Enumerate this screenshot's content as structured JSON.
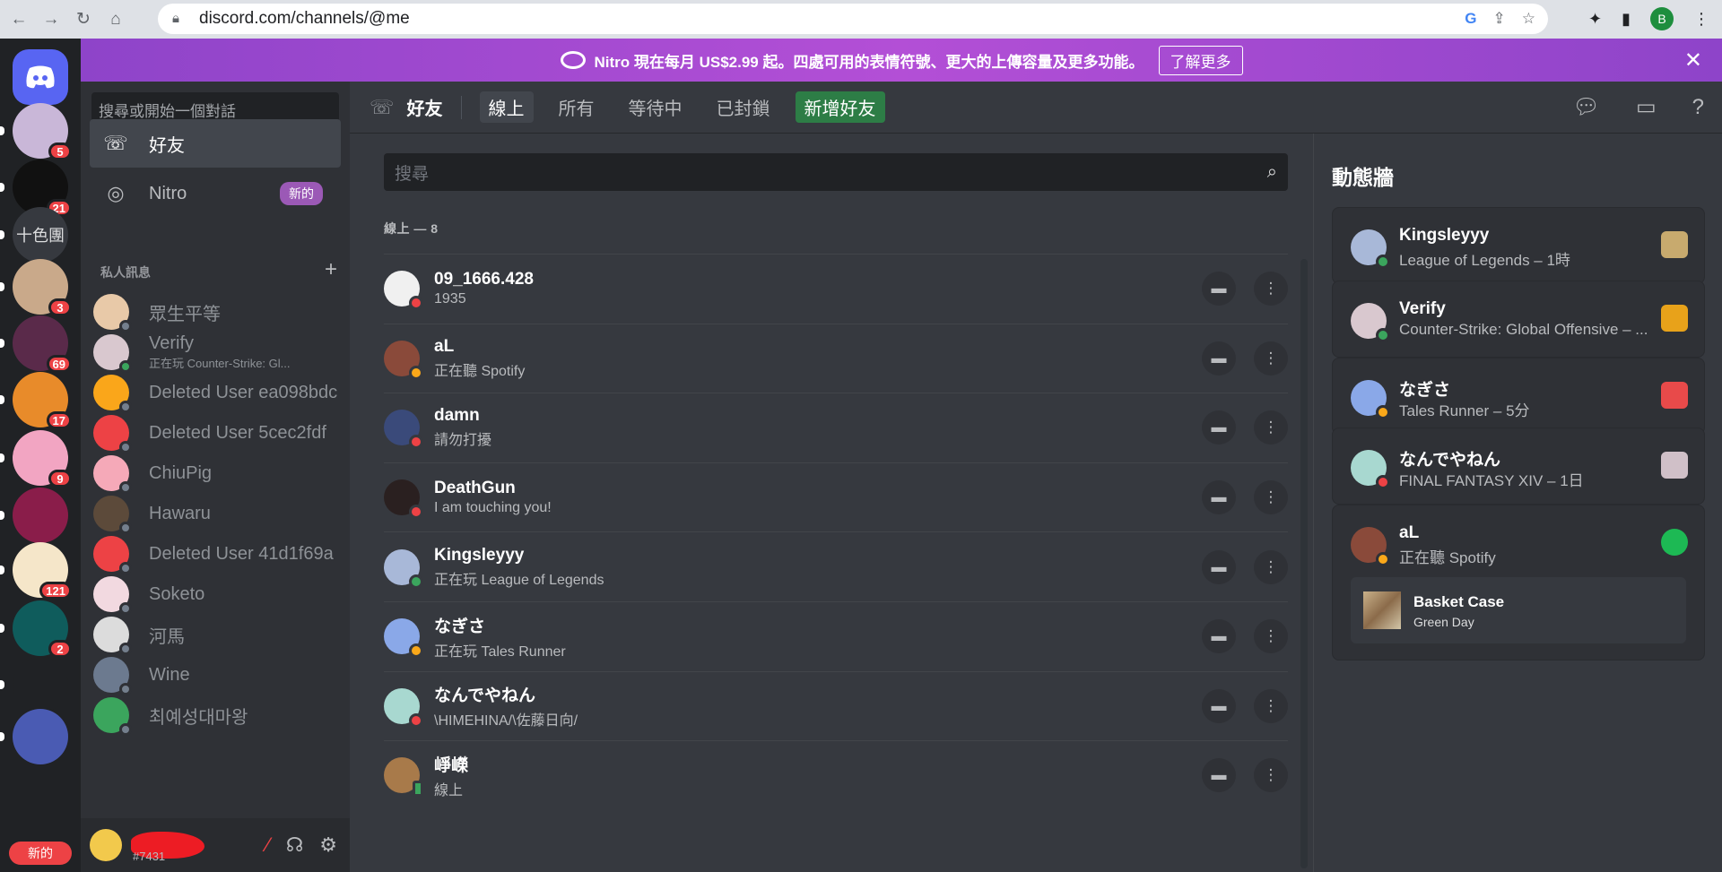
{
  "browser": {
    "url": "discord.com/channels/@me",
    "profile_initial": "B"
  },
  "banner": {
    "text": "Nitro 現在每月 US$2.99 起。四處可用的表情符號、更大的上傳容量及更多功能。",
    "button": "了解更多",
    "close": "✕"
  },
  "rail": {
    "servers": [
      {
        "label": "",
        "badge": "5",
        "color": "#c9b7d8"
      },
      {
        "label": "",
        "badge": "21",
        "color": "#111111"
      },
      {
        "label": "十色團",
        "badge": "",
        "color": "#36393f"
      },
      {
        "label": "",
        "badge": "3",
        "color": "#c9a98a"
      },
      {
        "label": "",
        "badge": "69",
        "color": "#5a2a4a"
      },
      {
        "label": "",
        "badge": "17",
        "color": "#e88b2a"
      },
      {
        "label": "",
        "badge": "9",
        "color": "#f2a5c2"
      },
      {
        "label": "",
        "badge": "",
        "color": "#8a1d4a"
      },
      {
        "label": "",
        "badge": "121",
        "color": "#f5e6c9"
      },
      {
        "label": "",
        "badge": "2",
        "color": "#0f5c5c"
      },
      {
        "label": "",
        "badge": "",
        "color": "#202225"
      },
      {
        "label": "",
        "badge": "",
        "color": "#4a5bb3"
      }
    ],
    "new_label": "新的"
  },
  "sidebar": {
    "search_placeholder": "搜尋或開始一個對話",
    "nav": [
      {
        "label": "好友"
      },
      {
        "label": "Nitro",
        "tag": "新的"
      }
    ],
    "dm_header": "私人訊息",
    "dms": [
      {
        "name": "眾生平等",
        "sub": "",
        "color": "#e8c9a8",
        "status": "offline"
      },
      {
        "name": "Verify",
        "sub": "正在玩 Counter-Strike: Gl...",
        "color": "#d9c8cf",
        "status": "online"
      },
      {
        "name": "Deleted User ea098bdc",
        "sub": "",
        "color": "#faa61a",
        "status": "offline"
      },
      {
        "name": "Deleted User 5cec2fdf",
        "sub": "",
        "color": "#ed4245",
        "status": "offline"
      },
      {
        "name": "ChiuPig",
        "sub": "",
        "color": "#f5a9b8",
        "status": "offline"
      },
      {
        "name": "Hawaru",
        "sub": "",
        "color": "#5c4a3a",
        "status": "offline"
      },
      {
        "name": "Deleted User 41d1f69a",
        "sub": "",
        "color": "#ed4245",
        "status": "offline"
      },
      {
        "name": "Soketo",
        "sub": "",
        "color": "#f2d9e0",
        "status": "offline"
      },
      {
        "name": "河馬",
        "sub": "",
        "color": "#dcdcdc",
        "status": "offline"
      },
      {
        "name": "Wine",
        "sub": "",
        "color": "#6c7a8f",
        "status": "offline"
      },
      {
        "name": "최예성대마왕",
        "sub": "",
        "color": "#3ba55d",
        "status": "offline"
      }
    ]
  },
  "user": {
    "tag": "#7431"
  },
  "header": {
    "title": "好友",
    "tabs": [
      "線上",
      "所有",
      "等待中",
      "已封鎖"
    ],
    "add_friend": "新增好友"
  },
  "friends": {
    "search_placeholder": "搜尋",
    "count_label": "線上 — 8",
    "list": [
      {
        "name": "09_1666.428",
        "sub": "1935",
        "status": "dnd",
        "color": "#f0f0f0"
      },
      {
        "name": "aL",
        "sub": "正在聽 Spotify",
        "status": "idle",
        "color": "#8a4a3a"
      },
      {
        "name": "damn",
        "sub": "請勿打擾",
        "status": "dnd",
        "color": "#3a4a7a"
      },
      {
        "name": "DeathGun",
        "sub": "I am touching you!",
        "status": "dnd",
        "color": "#2a2020"
      },
      {
        "name": "Kingsleyyy",
        "sub": "正在玩 League of Legends",
        "status": "online",
        "color": "#a8b8d8"
      },
      {
        "name": "なぎさ",
        "sub": "正在玩 Tales Runner",
        "status": "idle",
        "color": "#8aa8e8"
      },
      {
        "name": "なんでやねん",
        "sub": "\\HIMEHINA/\\佐藤日向/",
        "status": "dnd",
        "color": "#a8d8d0"
      },
      {
        "name": "崢嶸",
        "sub": "線上",
        "status": "mobile",
        "color": "#a87a4a"
      }
    ]
  },
  "activity": {
    "title": "動態牆",
    "cards": [
      {
        "name": "Kingsleyyy",
        "sub": "League of Legends – 1時",
        "status": "online",
        "color": "#a8b8d8",
        "icon_color": "#c8aa6e"
      },
      {
        "name": "Verify",
        "sub": "Counter-Strike: Global Offensive – ...",
        "status": "online",
        "color": "#d9c8cf",
        "icon_color": "#e8a21a"
      },
      {
        "name": "なぎさ",
        "sub": "Tales Runner – 5分",
        "status": "idle",
        "color": "#8aa8e8",
        "icon_color": "#e84a4a"
      },
      {
        "name": "なんでやねん",
        "sub": "FINAL FANTASY XIV – 1日",
        "status": "dnd",
        "color": "#a8d8d0",
        "icon_color": "#d0c0c8"
      },
      {
        "name": "aL",
        "sub": "正在聽 Spotify",
        "status": "idle",
        "color": "#8a4a3a",
        "icon_color": "#1db954"
      }
    ],
    "song": {
      "title": "Basket Case",
      "artist": "Green Day"
    }
  }
}
